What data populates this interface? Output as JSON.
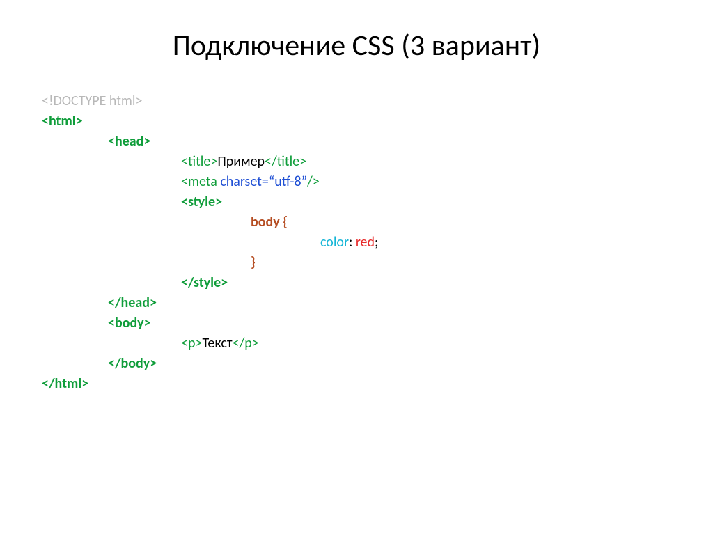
{
  "title": "Подключение CSS (3 вариант)",
  "code": {
    "doctype": "<!DOCTYPE html>",
    "html_open": "<html>",
    "head_open": "<head>",
    "title_open": "<title>",
    "title_text": "Пример",
    "title_close": "</title>",
    "meta_open": "<meta ",
    "meta_attr": "charset=“utf-8”",
    "meta_close": "/>",
    "style_open": "<style>",
    "css_selector": "body {",
    "css_prop": "color",
    "css_colon": ": ",
    "css_value": "red",
    "css_semicolon": ";",
    "css_close_brace": "}",
    "style_close": "</style>",
    "head_close": "</head>",
    "body_open": "<body>",
    "p_open": "<p>",
    "p_text": "Текст",
    "p_close": "</p>",
    "body_close": "</body>",
    "html_close": "</html>"
  }
}
